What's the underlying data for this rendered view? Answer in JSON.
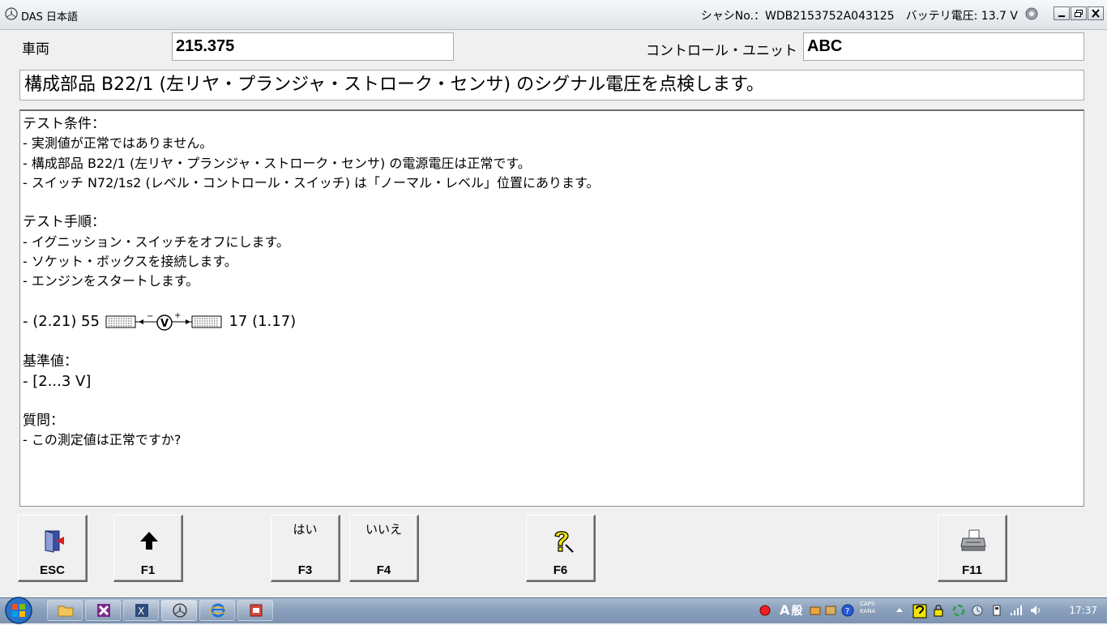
{
  "window": {
    "title": "DAS 日本語",
    "chassis_text": "シャシNo.：WDB2153752A043125　バッテリ電圧: 13.7 V"
  },
  "vehicle": {
    "label": "車両",
    "value": "215.375"
  },
  "control_unit": {
    "label": "コントロール・ユニット",
    "value": "ABC"
  },
  "heading": "構成部品 B22/1 (左リヤ・プランジャ・ストローク・センサ) のシグナル電圧を点検します。",
  "content": {
    "conditions_title": "テスト条件：",
    "conditions": [
      "- 実測値が正常ではありません。",
      "- 構成部品 B22/1 (左リヤ・プランジャ・ストローク・センサ) の電源電圧は正常です。",
      "- スイッチ N72/1s2 (レベル・コントロール・スイッチ) は「ノーマル・レベル」位置にあります。"
    ],
    "procedure_title": "テスト手順：",
    "procedure": [
      "- イグニッション・スイッチをオフにします。",
      "- ソケット・ボックスを接続します。",
      "- エンジンをスタートします。"
    ],
    "measurement": {
      "prefix": "- (2.21) 55",
      "minus": "−",
      "meter": "V",
      "plus": "+",
      "suffix": "17 (1.17)"
    },
    "reference_title": "基準値：",
    "reference": "- [2...3 V]",
    "question_title": "質問：",
    "question": "- この測定値は正常ですか?"
  },
  "fkeys": {
    "esc": {
      "label": "ESC",
      "icon": "exit-door-icon"
    },
    "f1": {
      "label": "F1",
      "icon": "arrow-up-icon"
    },
    "f3": {
      "label": "F3",
      "text": "はい"
    },
    "f4": {
      "label": "F4",
      "text": "いいえ"
    },
    "f6": {
      "label": "F6",
      "icon": "help-question-icon"
    },
    "f11": {
      "label": "F11",
      "icon": "printer-icon"
    }
  },
  "taskbar": {
    "clock": "17:37",
    "ime_mode": "A",
    "ime_kanji": "般",
    "caps": "CAPS",
    "kana": "KANA"
  },
  "colors": {
    "titlebar": "#dfe3e8",
    "taskbar": "#8aa0bc",
    "help_icon": "#f2e600",
    "window_bg": "#f0f0f0"
  }
}
